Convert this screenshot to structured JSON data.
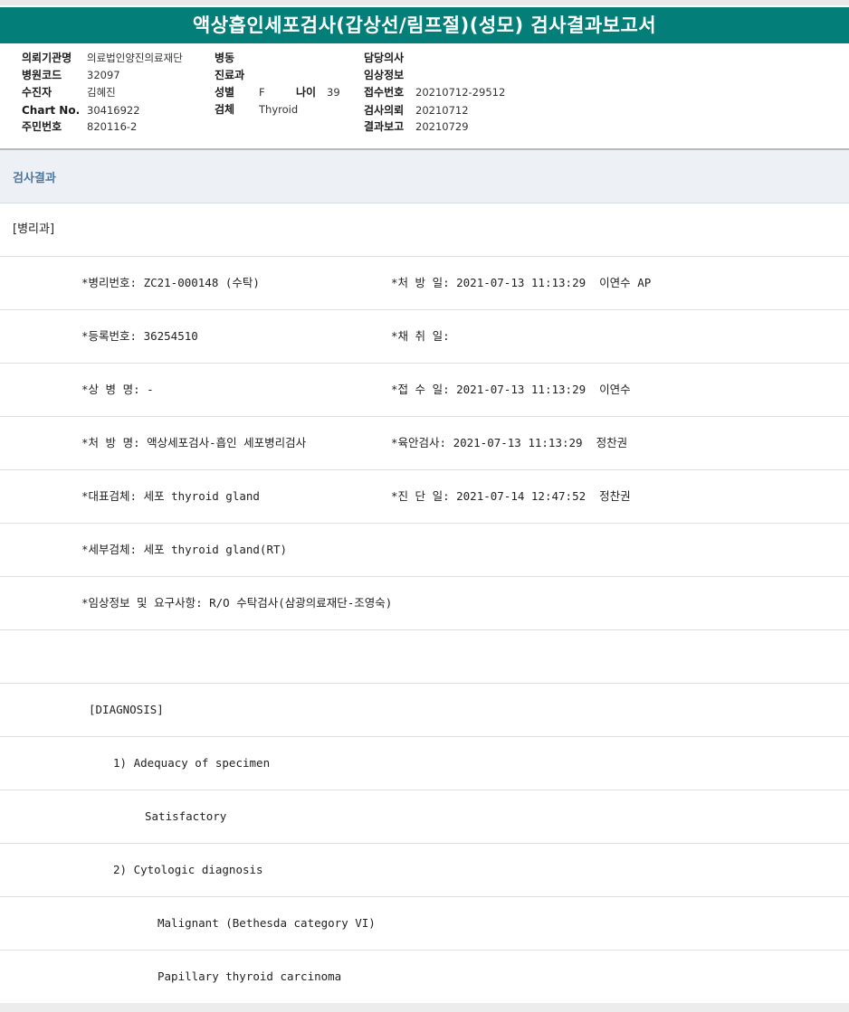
{
  "report": {
    "title": "액상흡인세포검사(갑상선/림프절)(성모) 검사결과보고서"
  },
  "patient_info": {
    "institution_label": "의뢰기관명",
    "institution_value": "의료법인양진의료재단",
    "hospital_code_label": "병원코드",
    "hospital_code_value": "32097",
    "examinee_label": "수진자",
    "examinee_value": "김혜진",
    "chart_no_label": "Chart No.",
    "chart_no_value": "30416922",
    "resident_no_label": "주민번호",
    "resident_no_value": "820116-2",
    "ward_label": "병동",
    "ward_value": "",
    "dept_label": "진료과",
    "dept_value": "",
    "sex_label": "성별",
    "sex_value": "F",
    "age_label": "나이",
    "age_value": "39",
    "specimen_label": "검체",
    "specimen_value": "Thyroid",
    "doctor_label": "담당의사",
    "doctor_value": "",
    "clinical_info_label": "임상정보",
    "clinical_info_value": "",
    "receipt_no_label": "접수번호",
    "receipt_no_value": "20210712-29512",
    "request_date_label": "검사의뢰",
    "request_date_value": "20210712",
    "report_date_label": "결과보고",
    "report_date_value": "20210729"
  },
  "results": {
    "section_title": "검사결과",
    "department": "[병리과]",
    "lines": [
      {
        "left": "*병리번호: ZC21-000148 (수탁)",
        "right": "*처 방 일: 2021-07-13 11:13:29  이연수 AP"
      },
      {
        "left": "*등록번호: 36254510",
        "right": "*채 취 일:"
      },
      {
        "left": "*상 병 명: -",
        "right": "*접 수 일: 2021-07-13 11:13:29  이연수"
      },
      {
        "left": "*처 방 명: 액상세포검사-흡인 세포병리검사",
        "right": "*육안검사: 2021-07-13 11:13:29  정찬권"
      },
      {
        "left": "*대표검체: 세포 thyroid gland",
        "right": "*진 단 일: 2021-07-14 12:47:52  정찬권"
      },
      {
        "left": "*세부검체: 세포 thyroid gland(RT)",
        "right": ""
      },
      {
        "left": "*임상정보 및 요구사항: R/O 수탁검사(삼광의료재단-조영숙)",
        "right": ""
      }
    ],
    "diagnosis_header": "[DIAGNOSIS]",
    "adequacy_heading": "1) Adequacy of specimen",
    "adequacy_value": "Satisfactory",
    "cytologic_heading": "2) Cytologic diagnosis",
    "cytologic_value_1": "Malignant (Bethesda category VI)",
    "cytologic_value_2": "Papillary thyroid carcinoma"
  }
}
